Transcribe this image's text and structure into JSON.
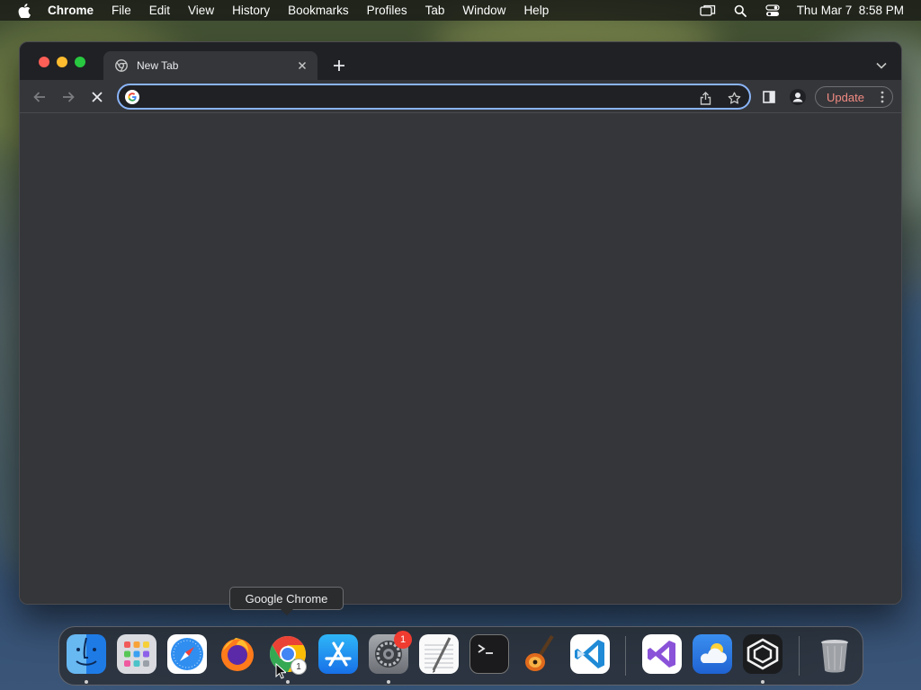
{
  "menubar": {
    "app_name": "Chrome",
    "menus": [
      "File",
      "Edit",
      "View",
      "History",
      "Bookmarks",
      "Profiles",
      "Tab",
      "Window",
      "Help"
    ],
    "clock": "Thu Mar 7  8:58 PM"
  },
  "browser": {
    "tab": {
      "title": "New Tab"
    },
    "omnibox": {
      "value": "",
      "placeholder": ""
    },
    "update_label": "Update",
    "theme": {
      "accent": "#8ab4f8",
      "frame": "#202124",
      "toolbar": "#35363a",
      "update_text": "#f28b82"
    }
  },
  "dock": {
    "tooltip": "Google Chrome",
    "apps": [
      {
        "name": "Finder",
        "icon": "finder-icon"
      },
      {
        "name": "Launchpad",
        "icon": "launchpad-icon"
      },
      {
        "name": "Safari",
        "icon": "safari-icon"
      },
      {
        "name": "Firefox",
        "icon": "firefox-icon"
      },
      {
        "name": "Google Chrome",
        "icon": "chrome-icon"
      },
      {
        "name": "App Store",
        "icon": "app-store-icon"
      },
      {
        "name": "System Settings",
        "icon": "system-settings-icon"
      },
      {
        "name": "TextEdit",
        "icon": "textedit-icon"
      },
      {
        "name": "Terminal",
        "icon": "terminal-icon"
      },
      {
        "name": "GarageBand",
        "icon": "garageband-icon"
      },
      {
        "name": "Visual Studio Code",
        "icon": "vscode-icon"
      },
      {
        "name": "Visual Studio",
        "icon": "visual-studio-icon"
      },
      {
        "name": "Weather",
        "icon": "weather-icon"
      },
      {
        "name": "Ghostery",
        "icon": "cube-app-icon"
      },
      {
        "name": "Trash",
        "icon": "trash-icon"
      }
    ],
    "settings_badge": "1",
    "chrome_badge": "1"
  }
}
